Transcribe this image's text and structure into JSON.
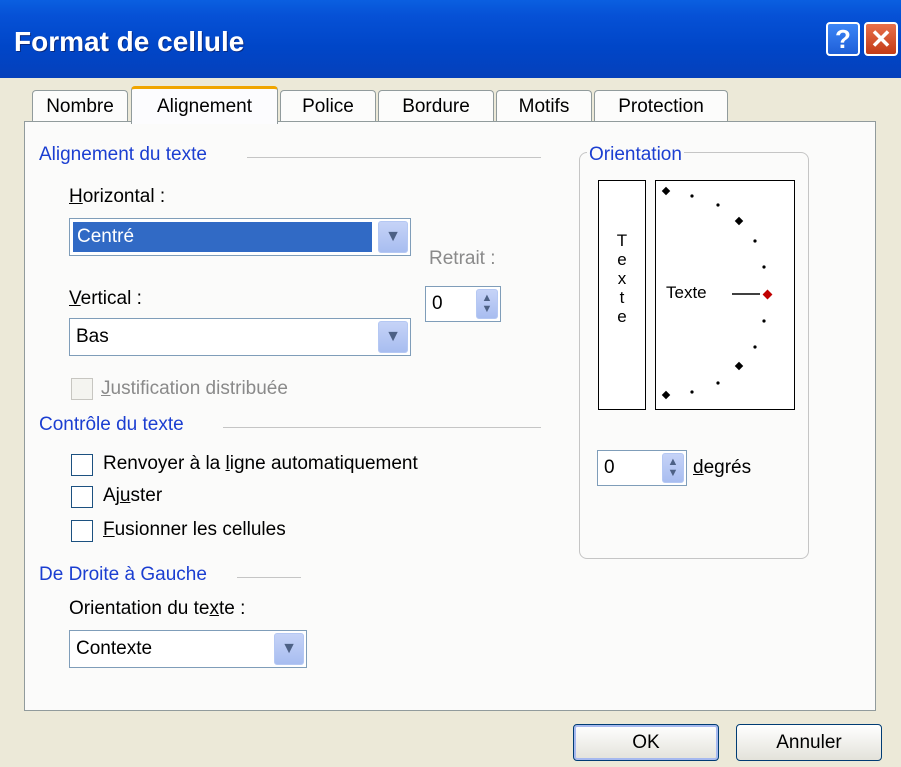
{
  "window": {
    "title": "Format de cellule",
    "help_label": "?",
    "close_label": "✕"
  },
  "tabs": [
    {
      "label": "Nombre"
    },
    {
      "label": "Alignement"
    },
    {
      "label": "Police"
    },
    {
      "label": "Bordure"
    },
    {
      "label": "Motifs"
    },
    {
      "label": "Protection"
    }
  ],
  "active_tab": "Alignement",
  "text_alignment": {
    "section_title": "Alignement du texte",
    "horizontal": {
      "label_first": "H",
      "label_rest": "orizontal :",
      "value": "Centré"
    },
    "indent": {
      "label": "Retrait :",
      "value": "0"
    },
    "vertical": {
      "label_first": "V",
      "label_rest": "ertical :",
      "value": "Bas"
    },
    "distributed": {
      "label_first": "J",
      "label_rest": "ustification distribuée",
      "checked": false,
      "enabled": false
    }
  },
  "text_control": {
    "section_title": "Contrôle du texte",
    "wrap": {
      "label_pre": "Renvoyer à la ",
      "label_ul": "l",
      "label_post": "igne automatiquement",
      "checked": false
    },
    "shrink": {
      "label_pre": "Aj",
      "label_ul": "u",
      "label_post": "ster",
      "checked": false
    },
    "merge": {
      "label_pre": "",
      "label_ul": "F",
      "label_post": "usionner les cellules",
      "checked": false
    }
  },
  "rtl": {
    "section_title": "De Droite à Gauche",
    "direction": {
      "label_pre": "Orientation du te",
      "label_ul": "x",
      "label_post": "te :",
      "value": "Contexte"
    }
  },
  "orientation": {
    "section_title": "Orientation",
    "vertical_text": [
      "T",
      "e",
      "x",
      "t",
      "e"
    ],
    "dial_label": "Texte",
    "degrees_value": "0",
    "degrees_label_ul": "d",
    "degrees_label_rest": "egrés",
    "angle": 0
  },
  "buttons": {
    "ok": "OK",
    "cancel": "Annuler"
  },
  "icons": {
    "dropdown": "chevron-down-icon",
    "spinner": "spin-arrows-icon",
    "dial_marker": "diamond-icon"
  },
  "colors": {
    "title_bar": "#0046c8",
    "section_text": "#1b3ed1",
    "selection": "#316ac5",
    "dial_active": "#c00000"
  }
}
